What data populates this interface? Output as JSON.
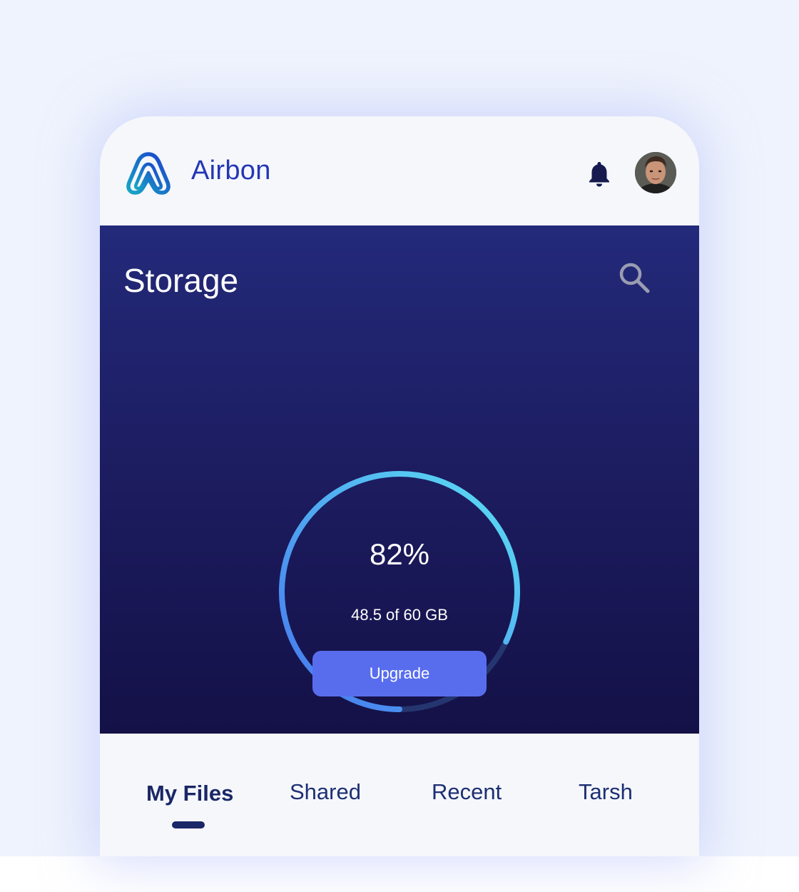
{
  "app": {
    "brand_name": "Airbon",
    "logo_icon": "airbon-logo-icon",
    "accent_color": "#2437b4"
  },
  "header": {
    "notification_icon": "bell-icon",
    "avatar_icon": "user-avatar"
  },
  "storage": {
    "title": "Storage",
    "search_icon": "search-icon",
    "usage_percent_label": "82%",
    "usage_fraction": 0.82,
    "usage_detail": "48.5 of 60 GB",
    "upgrade_label": "Upgrade",
    "gauge_colors": [
      "#4a7cf0",
      "#57d6f2"
    ],
    "button_color": "#586dee"
  },
  "tabs": {
    "items": [
      {
        "label": "My Files",
        "active": true
      },
      {
        "label": "Shared",
        "active": false
      },
      {
        "label": "Recent",
        "active": false
      },
      {
        "label": "Tarsh",
        "active": false
      }
    ]
  }
}
